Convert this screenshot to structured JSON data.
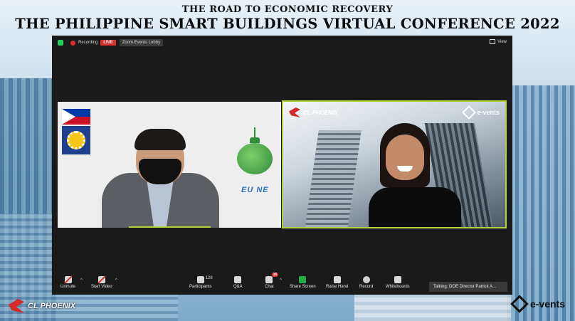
{
  "heading": {
    "subtitle": "THE ROAD TO ECONOMIC RECOVERY",
    "title": "THE PHILIPPINE SMART BUILDINGS VIRTUAL CONFERENCE 2022"
  },
  "zoom": {
    "recording_label": "Recording",
    "live_badge": "LIVE",
    "lobby_label": "Zoom Events Lobby",
    "view_label": "View",
    "left_tile": {
      "logo_text": "EU NE"
    },
    "right_tile": {
      "brand_left": "CL PHOENIX",
      "brand_right": "e-vents"
    },
    "toolbar": {
      "unmute": "Unmute",
      "start_video": "Start Video",
      "participants": "Participants",
      "participants_count": "128",
      "qa": "Q&A",
      "chat": "Chat",
      "chat_badge": "35",
      "share_screen": "Share Screen",
      "raise_hand": "Raise Hand",
      "record": "Record",
      "whiteboards": "Whiteboards"
    },
    "talking": "Talking: DOE Director Patrick A..."
  },
  "footer": {
    "left_brand": "CL PHOENIX",
    "right_brand": "e-vents"
  },
  "colors": {
    "live_red": "#e02e2e",
    "active_speaker_border": "#b3d33d",
    "share_green": "#23b04a"
  }
}
